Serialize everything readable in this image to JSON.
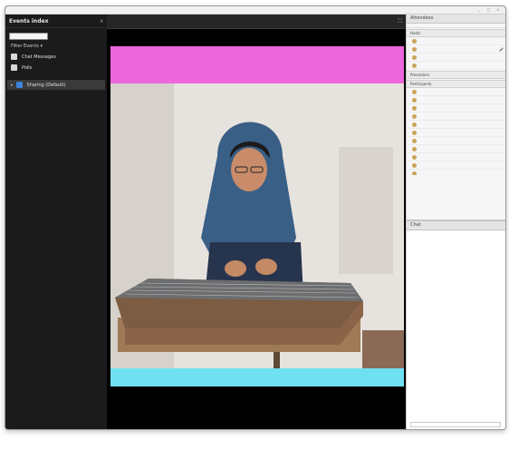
{
  "window": {
    "title": "",
    "controls": "_ □ x"
  },
  "left_panel": {
    "title": "Events index",
    "close": "x",
    "search_placeholder": "",
    "filter_label": "Filter Events ▾",
    "items": [
      {
        "label": "Chat Messages"
      },
      {
        "label": "Polls"
      }
    ],
    "selected_item": {
      "label": "Sharing (Default)"
    }
  },
  "center": {
    "header_title": "",
    "maximize": "⛶"
  },
  "attendees": {
    "title": "Attendees",
    "count_badge": "",
    "sub": "",
    "hosts_group": "Hosts",
    "hosts": [
      {
        "name": "",
        "mic": ""
      },
      {
        "name": "",
        "mic": "🎤"
      },
      {
        "name": "",
        "mic": ""
      },
      {
        "name": "",
        "mic": ""
      }
    ],
    "presenters_group": "Presenters",
    "participants_group": "Participants",
    "participants": [
      {
        "name": ""
      },
      {
        "name": ""
      },
      {
        "name": ""
      },
      {
        "name": ""
      },
      {
        "name": ""
      },
      {
        "name": ""
      },
      {
        "name": ""
      },
      {
        "name": ""
      },
      {
        "name": ""
      },
      {
        "name": ""
      },
      {
        "name": ""
      }
    ]
  },
  "chat": {
    "title": "Chat",
    "messages": [
      "",
      "",
      "",
      "",
      "",
      "",
      "",
      "",
      "",
      "",
      "",
      "",
      "",
      "",
      "",
      "",
      "",
      "",
      "",
      ""
    ],
    "input_placeholder": ""
  },
  "colors": {
    "top_band": "#ee67dc",
    "bottom_band": "#6fe0f1",
    "selected_icon": "#3d82d8"
  }
}
